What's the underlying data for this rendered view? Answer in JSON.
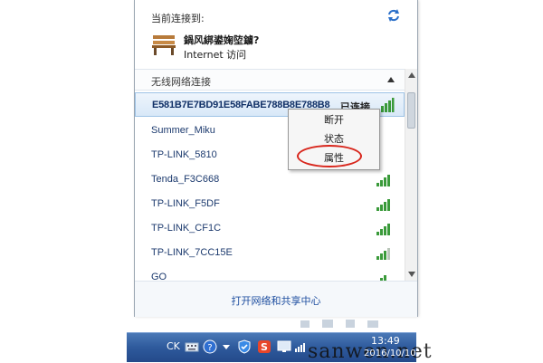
{
  "current": {
    "label": "当前连接到:",
    "network_name": "鍋风綁鍙婅埅鐪?",
    "network_status": "Internet 访问"
  },
  "wireless": {
    "section_title": "无线网络连接",
    "connected_label": "已连接",
    "networks": [
      {
        "ssid": "E581B7E7BD91E58FABE788B8E788B8",
        "connected": true
      },
      {
        "ssid": "Summer_Miku"
      },
      {
        "ssid": "TP-LINK_5810"
      },
      {
        "ssid": "Tenda_F3C668"
      },
      {
        "ssid": "TP-LINK_F5DF"
      },
      {
        "ssid": "TP-LINK_CF1C"
      },
      {
        "ssid": "TP-LINK_7CC15E"
      },
      {
        "ssid": "GO"
      }
    ]
  },
  "context_menu": {
    "items": [
      "断开",
      "状态",
      "属性"
    ]
  },
  "footer": {
    "link": "打开网络和共享中心"
  },
  "taskbar": {
    "lang": "CK",
    "time": "13:49",
    "date": "2016/10/10",
    "watermark": "sanwen.net"
  },
  "icons": {
    "refresh": "refresh-icon",
    "network": "bench-network-icon",
    "signal": "wifi-signal-icon",
    "collapse": "chevron-up-icon"
  }
}
